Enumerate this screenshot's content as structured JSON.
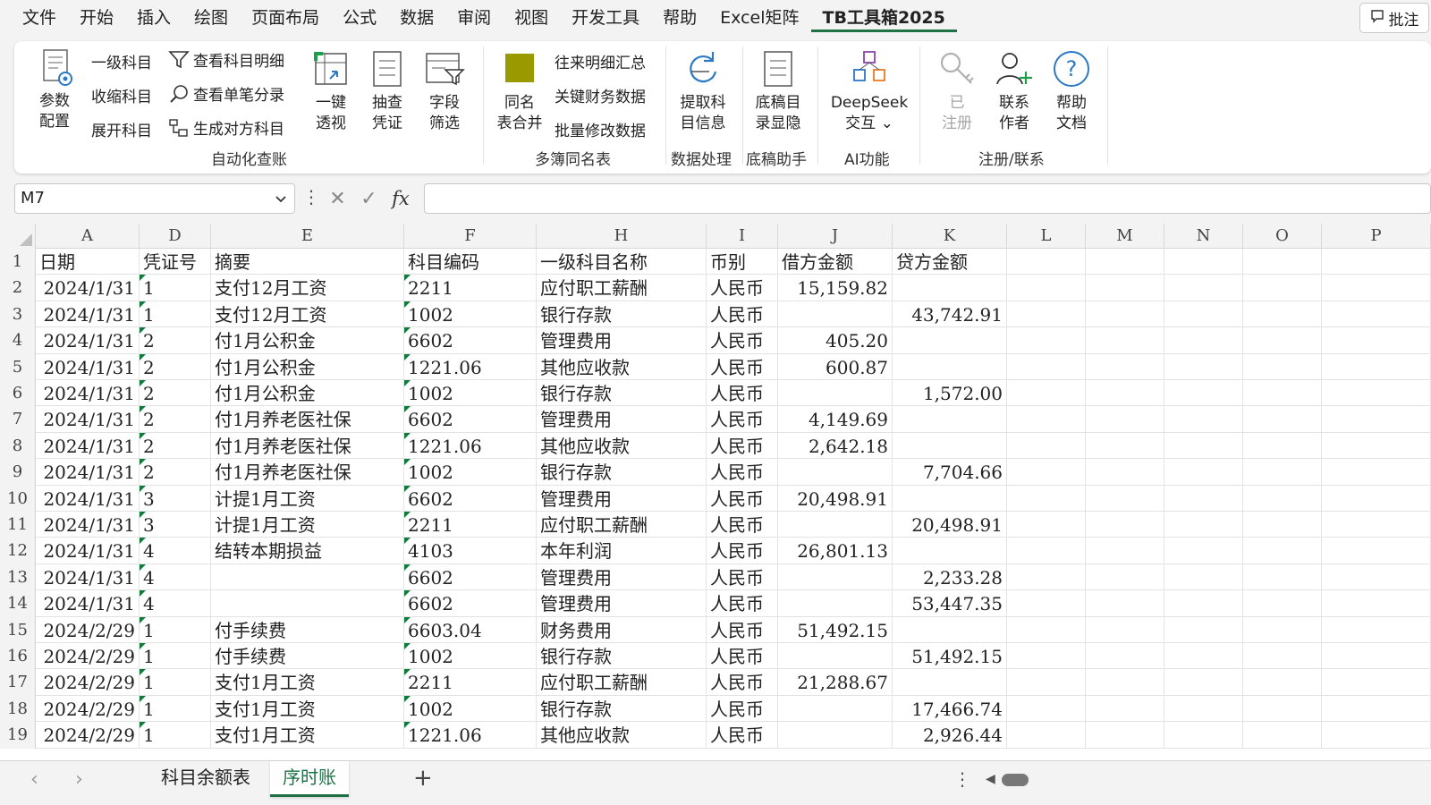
{
  "menu": {
    "tabs": [
      "文件",
      "开始",
      "插入",
      "绘图",
      "页面布局",
      "公式",
      "数据",
      "审阅",
      "视图",
      "开发工具",
      "帮助",
      "Excel矩阵",
      "TB工具箱2025"
    ],
    "active": "TB工具箱2025",
    "comment_label": "批注"
  },
  "ribbon": {
    "param_config": "参数\n配置",
    "level1": "一级科目",
    "collapse": "收缩科目",
    "expand": "展开科目",
    "view_detail": "查看科目明细",
    "view_single": "查看单笔分录",
    "gen_opposite": "生成对方科目",
    "one_click_line1": "一键",
    "one_click_line2": "透视",
    "sample_line1": "抽查",
    "sample_line2": "凭证",
    "field_line1": "字段",
    "field_line2": "筛选",
    "group_auto": "自动化查账",
    "merge_line1": "同名",
    "merge_line2": "表合并",
    "dealings": "往来明细汇总",
    "key_fin": "关键财务数据",
    "batch_edit": "批量修改数据",
    "group_multi": "多簿同名表",
    "extract_line1": "提取科",
    "extract_line2": "目信息",
    "group_data": "数据处理",
    "draft_line1": "底稿目",
    "draft_line2": "录显隐",
    "group_draft": "底稿助手",
    "deepseek_line1": "DeepSeek",
    "deepseek_line2": "交互 ⌄",
    "group_ai": "AI功能",
    "registered_line1": "已",
    "registered_line2": "注册",
    "contact_line1": "联系",
    "contact_line2": "作者",
    "help_line1": "帮助",
    "help_line2": "文档",
    "group_reg": "注册/联系"
  },
  "formula_bar": {
    "name_box": "M7",
    "formula": ""
  },
  "columns": [
    "A",
    "D",
    "E",
    "F",
    "H",
    "I",
    "J",
    "K",
    "L",
    "M",
    "N",
    "O",
    "P"
  ],
  "header_row": [
    "日期",
    "凭证号",
    "摘要",
    "科目编码",
    "一级科目名称",
    "币别",
    "借方金额",
    "贷方金额"
  ],
  "rows": [
    {
      "n": "2",
      "date": "2024/1/31",
      "v": "1",
      "memo": "支付12月工资",
      "code": "2211",
      "name": "应付职工薪酬",
      "cur": "人民币",
      "dr": "15,159.82",
      "cr": ""
    },
    {
      "n": "3",
      "date": "2024/1/31",
      "v": "1",
      "memo": "支付12月工资",
      "code": "1002",
      "name": "银行存款",
      "cur": "人民币",
      "dr": "",
      "cr": "43,742.91"
    },
    {
      "n": "4",
      "date": "2024/1/31",
      "v": "2",
      "memo": "付1月公积金",
      "code": "6602",
      "name": "管理费用",
      "cur": "人民币",
      "dr": "405.20",
      "cr": ""
    },
    {
      "n": "5",
      "date": "2024/1/31",
      "v": "2",
      "memo": "付1月公积金",
      "code": "1221.06",
      "name": "其他应收款",
      "cur": "人民币",
      "dr": "600.87",
      "cr": ""
    },
    {
      "n": "6",
      "date": "2024/1/31",
      "v": "2",
      "memo": "付1月公积金",
      "code": "1002",
      "name": "银行存款",
      "cur": "人民币",
      "dr": "",
      "cr": "1,572.00"
    },
    {
      "n": "7",
      "date": "2024/1/31",
      "v": "2",
      "memo": "付1月养老医社保",
      "code": "6602",
      "name": "管理费用",
      "cur": "人民币",
      "dr": "4,149.69",
      "cr": ""
    },
    {
      "n": "8",
      "date": "2024/1/31",
      "v": "2",
      "memo": "付1月养老医社保",
      "code": "1221.06",
      "name": "其他应收款",
      "cur": "人民币",
      "dr": "2,642.18",
      "cr": ""
    },
    {
      "n": "9",
      "date": "2024/1/31",
      "v": "2",
      "memo": "付1月养老医社保",
      "code": "1002",
      "name": "银行存款",
      "cur": "人民币",
      "dr": "",
      "cr": "7,704.66"
    },
    {
      "n": "10",
      "date": "2024/1/31",
      "v": "3",
      "memo": "计提1月工资",
      "code": "6602",
      "name": "管理费用",
      "cur": "人民币",
      "dr": "20,498.91",
      "cr": ""
    },
    {
      "n": "11",
      "date": "2024/1/31",
      "v": "3",
      "memo": "计提1月工资",
      "code": "2211",
      "name": "应付职工薪酬",
      "cur": "人民币",
      "dr": "",
      "cr": "20,498.91"
    },
    {
      "n": "12",
      "date": "2024/1/31",
      "v": "4",
      "memo": "结转本期损益",
      "code": "4103",
      "name": "本年利润",
      "cur": "人民币",
      "dr": "26,801.13",
      "cr": ""
    },
    {
      "n": "13",
      "date": "2024/1/31",
      "v": "4",
      "memo": "",
      "code": "6602",
      "name": "管理费用",
      "cur": "人民币",
      "dr": "",
      "cr": "2,233.28"
    },
    {
      "n": "14",
      "date": "2024/1/31",
      "v": "4",
      "memo": "",
      "code": "6602",
      "name": "管理费用",
      "cur": "人民币",
      "dr": "",
      "cr": "53,447.35"
    },
    {
      "n": "15",
      "date": "2024/2/29",
      "v": "1",
      "memo": "付手续费",
      "code": "6603.04",
      "name": "财务费用",
      "cur": "人民币",
      "dr": "51,492.15",
      "cr": ""
    },
    {
      "n": "16",
      "date": "2024/2/29",
      "v": "1",
      "memo": "付手续费",
      "code": "1002",
      "name": "银行存款",
      "cur": "人民币",
      "dr": "",
      "cr": "51,492.15"
    },
    {
      "n": "17",
      "date": "2024/2/29",
      "v": "1",
      "memo": "支付1月工资",
      "code": "2211",
      "name": "应付职工薪酬",
      "cur": "人民币",
      "dr": "21,288.67",
      "cr": ""
    },
    {
      "n": "18",
      "date": "2024/2/29",
      "v": "1",
      "memo": "支付1月工资",
      "code": "1002",
      "name": "银行存款",
      "cur": "人民币",
      "dr": "",
      "cr": "17,466.74"
    },
    {
      "n": "19",
      "date": "2024/2/29",
      "v": "1",
      "memo": "支付1月工资",
      "code": "1221.06",
      "name": "其他应收款",
      "cur": "人民币",
      "dr": "",
      "cr": "2,926.44"
    }
  ],
  "sheets": {
    "tabs": [
      "科目余额表",
      "序时账"
    ],
    "active": "序时账",
    "add_label": "+"
  }
}
